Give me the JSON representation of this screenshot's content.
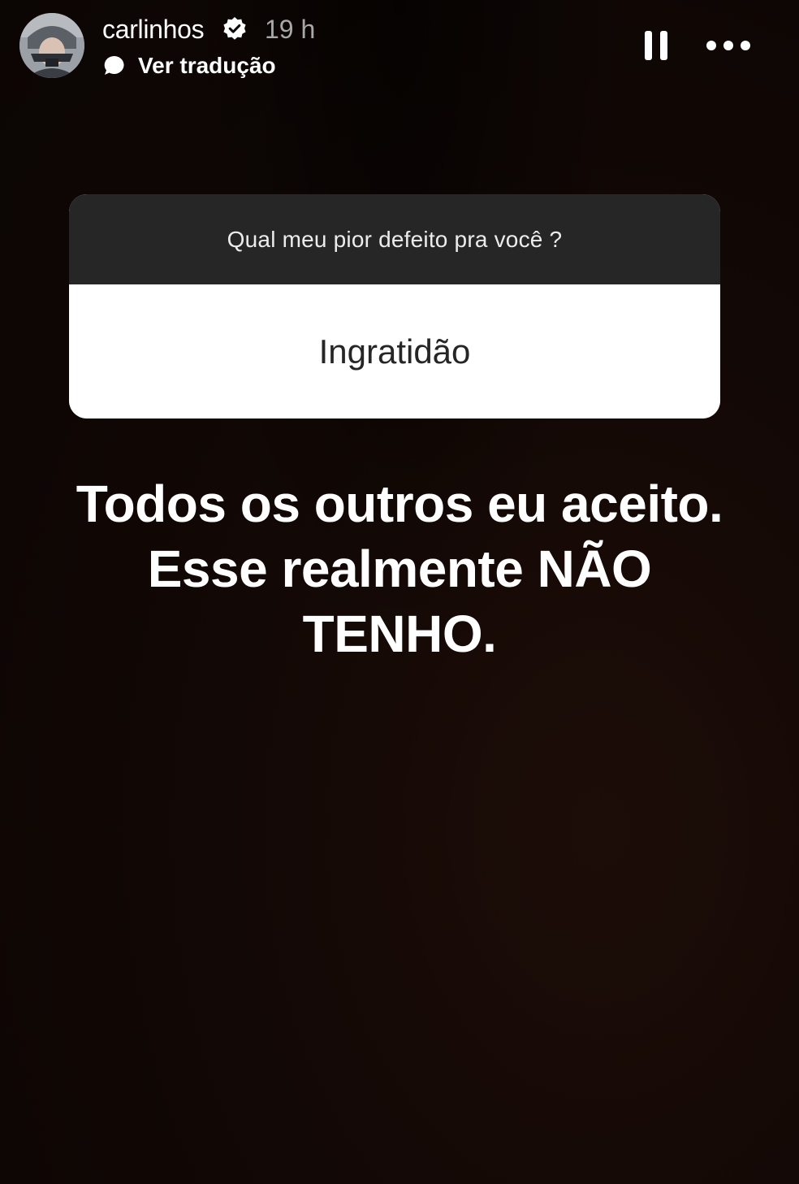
{
  "header": {
    "username": "carlinhos",
    "verified_icon": "verified-badge-icon",
    "timestamp": "19 h",
    "translate_icon": "speech-bubble-icon",
    "translate_label": "Ver tradução",
    "pause_icon": "pause-icon",
    "more_icon": "more-options-icon"
  },
  "question_sticker": {
    "question": "Qual meu pior defeito pra você ?",
    "answer": "Ingratidão"
  },
  "caption": {
    "lines": [
      "Todos os outros eu aceito.",
      "Esse realmente NÃO",
      "TENHO."
    ]
  },
  "colors": {
    "background": "#120805",
    "question_bar": "#262626",
    "answer_bg": "#ffffff",
    "answer_text": "#262626",
    "text": "#ffffff",
    "muted_text": "#a8a8a8"
  }
}
